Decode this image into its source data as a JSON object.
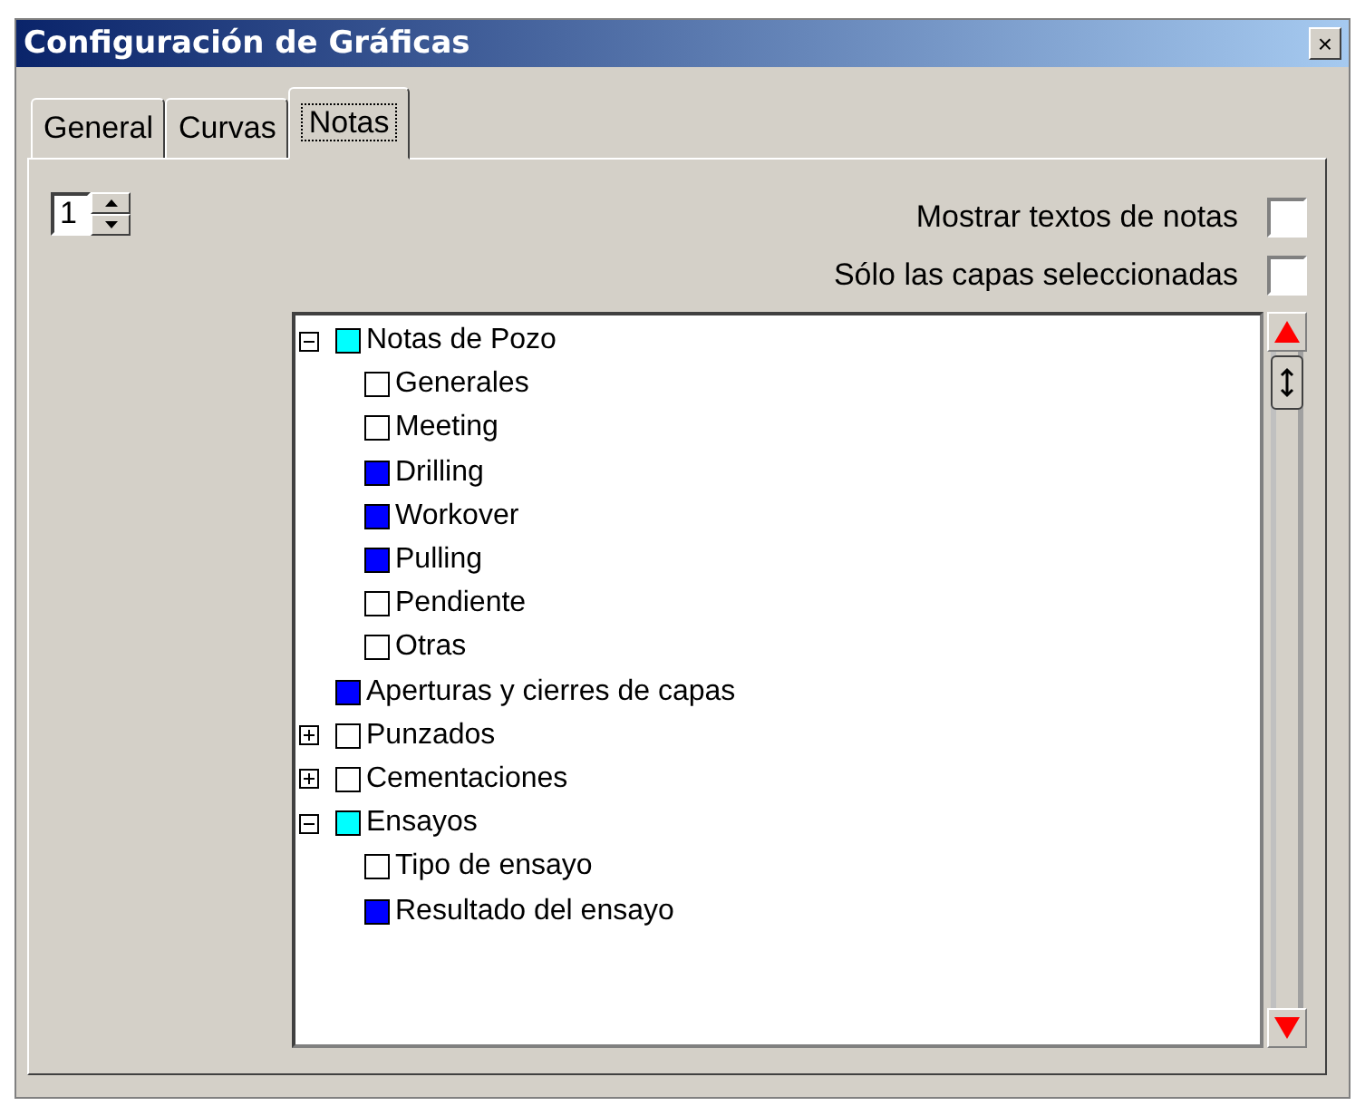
{
  "window": {
    "title": "Configuración de Gráficas",
    "close": "×"
  },
  "tabs": [
    {
      "label": "General",
      "selected": false
    },
    {
      "label": "Curvas",
      "selected": false
    },
    {
      "label": "Notas",
      "selected": true
    }
  ],
  "spinner": {
    "value": "1"
  },
  "options": [
    {
      "label": "Mostrar textos de notas",
      "checked": false
    },
    {
      "label": "Sólo las capas seleccionadas",
      "checked": false
    }
  ],
  "tree": [
    {
      "label": "Notas de Pozo",
      "color": "#00ffff",
      "expanded": true,
      "children": [
        {
          "label": "Generales",
          "color": "#ffffff"
        },
        {
          "label": "Meeting",
          "color": "#ffffff"
        },
        {
          "label": "Drilling",
          "color": "#0000ff"
        },
        {
          "label": "Workover",
          "color": "#0000ff"
        },
        {
          "label": "Pulling",
          "color": "#0000ff"
        },
        {
          "label": "Pendiente",
          "color": "#ffffff"
        },
        {
          "label": "Otras",
          "color": "#ffffff"
        }
      ]
    },
    {
      "label": "Aperturas y cierres de capas",
      "color": "#0000ff"
    },
    {
      "label": "Punzados",
      "color": "#ffffff",
      "expanded": false
    },
    {
      "label": "Cementaciones",
      "color": "#ffffff",
      "expanded": false
    },
    {
      "label": "Ensayos",
      "color": "#00ffff",
      "expanded": true,
      "children": [
        {
          "label": "Tipo de ensayo",
          "color": "#ffffff"
        },
        {
          "label": "Resultado del ensayo",
          "color": "#0000ff"
        }
      ]
    }
  ]
}
